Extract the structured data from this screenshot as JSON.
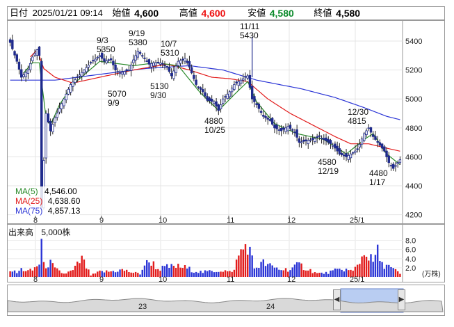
{
  "header": {
    "date_label": "日付",
    "datetime": "2025/01/21 09:14",
    "open_label": "始値",
    "open_value": "4,600",
    "high_label": "高値",
    "high_value": "4,600",
    "low_label": "安値",
    "low_value": "4,580",
    "close_label": "終値",
    "close_value": "4,580"
  },
  "legend": {
    "ma5_label": "MA(5)",
    "ma5_value": "4,546.00",
    "ma5_color": "#2a8a2a",
    "ma25_label": "MA(25)",
    "ma25_value": "4,638.60",
    "ma25_color": "#e21b1b",
    "ma75_label": "MA(75)",
    "ma75_value": "4,857.13",
    "ma75_color": "#2b35d6"
  },
  "volume": {
    "title": "出来高",
    "unit_label": "5,000株",
    "axis_unit": "(万株)",
    "ticks": [
      "8.0",
      "6.0",
      "4.0",
      "2.0"
    ]
  },
  "overview": {
    "labels": [
      "23",
      "24"
    ]
  },
  "chart_data": {
    "type": "candlestick",
    "y_ticks": [
      5400,
      5200,
      5000,
      4800,
      4600,
      4400,
      4200
    ],
    "ylim": [
      4150,
      5530
    ],
    "x_month_labels": [
      "8",
      "9",
      "10",
      "11",
      "12",
      "25/1"
    ],
    "annotations": [
      {
        "text": [
          "9/3",
          "5350"
        ]
      },
      {
        "text": [
          "9/19",
          "5380"
        ]
      },
      {
        "text": [
          "10/7",
          "5310"
        ]
      },
      {
        "text": [
          "11/11",
          "5430"
        ]
      },
      {
        "text": [
          "5070",
          "9/9"
        ]
      },
      {
        "text": [
          "5130",
          "9/30"
        ]
      },
      {
        "text": [
          "4880",
          "10/25"
        ]
      },
      {
        "text": [
          "12/30",
          "4815"
        ]
      },
      {
        "text": [
          "4580",
          "12/19"
        ]
      },
      {
        "text": [
          "4480",
          "1/17"
        ]
      }
    ],
    "close_anchors": [
      [
        0,
        5390
      ],
      [
        3,
        5260
      ],
      [
        5,
        5150
      ],
      [
        8,
        5200
      ],
      [
        10,
        5290
      ],
      [
        12,
        5340
      ],
      [
        13,
        5300
      ],
      [
        14,
        4250
      ],
      [
        16,
        4900
      ],
      [
        18,
        4780
      ],
      [
        20,
        4870
      ],
      [
        24,
        5000
      ],
      [
        27,
        5100
      ],
      [
        30,
        5150
      ],
      [
        33,
        5200
      ],
      [
        36,
        5250
      ],
      [
        40,
        5300
      ],
      [
        42,
        5260
      ],
      [
        45,
        5270
      ],
      [
        47,
        5200
      ],
      [
        49,
        5180
      ],
      [
        53,
        5200
      ],
      [
        55,
        5270
      ],
      [
        57,
        5330
      ],
      [
        60,
        5280
      ],
      [
        62,
        5240
      ],
      [
        64,
        5250
      ],
      [
        67,
        5250
      ],
      [
        70,
        5220
      ],
      [
        72,
        5160
      ],
      [
        75,
        5260
      ],
      [
        78,
        5280
      ],
      [
        80,
        5220
      ],
      [
        83,
        5100
      ],
      [
        86,
        5050
      ],
      [
        88,
        4990
      ],
      [
        91,
        4980
      ],
      [
        93,
        4920
      ],
      [
        95,
        5000
      ],
      [
        98,
        5050
      ],
      [
        100,
        5100
      ],
      [
        103,
        5130
      ],
      [
        106,
        5160
      ],
      [
        108,
        5000
      ],
      [
        110,
        4960
      ],
      [
        113,
        4880
      ],
      [
        116,
        4850
      ],
      [
        118,
        4800
      ],
      [
        121,
        4780
      ],
      [
        124,
        4810
      ],
      [
        127,
        4770
      ],
      [
        129,
        4700
      ],
      [
        132,
        4710
      ],
      [
        135,
        4720
      ],
      [
        138,
        4740
      ],
      [
        141,
        4710
      ],
      [
        144,
        4680
      ],
      [
        147,
        4620
      ],
      [
        150,
        4600
      ],
      [
        152,
        4620
      ],
      [
        155,
        4650
      ],
      [
        158,
        4760
      ],
      [
        160,
        4800
      ],
      [
        162,
        4740
      ],
      [
        165,
        4680
      ],
      [
        167,
        4640
      ],
      [
        169,
        4560
      ],
      [
        171,
        4520
      ],
      [
        173,
        4560
      ],
      [
        174,
        4580
      ]
    ],
    "ma5_anchors": [
      [
        6,
        5180
      ],
      [
        10,
        5250
      ],
      [
        13,
        5250
      ],
      [
        16,
        4870
      ],
      [
        18,
        4820
      ],
      [
        22,
        4960
      ],
      [
        28,
        5100
      ],
      [
        40,
        5260
      ],
      [
        55,
        5230
      ],
      [
        65,
        5250
      ],
      [
        75,
        5230
      ],
      [
        85,
        5040
      ],
      [
        93,
        4920
      ],
      [
        100,
        5030
      ],
      [
        106,
        5120
      ],
      [
        110,
        4980
      ],
      [
        118,
        4830
      ],
      [
        128,
        4760
      ],
      [
        140,
        4720
      ],
      [
        150,
        4620
      ],
      [
        158,
        4720
      ],
      [
        162,
        4760
      ],
      [
        168,
        4620
      ],
      [
        174,
        4546
      ]
    ],
    "ma25_anchors": [
      [
        9,
        5290
      ],
      [
        12,
        5340
      ],
      [
        15,
        5210
      ],
      [
        20,
        5150
      ],
      [
        28,
        5110
      ],
      [
        40,
        5150
      ],
      [
        55,
        5200
      ],
      [
        70,
        5240
      ],
      [
        80,
        5200
      ],
      [
        90,
        5150
      ],
      [
        98,
        5140
      ],
      [
        106,
        5120
      ],
      [
        115,
        5000
      ],
      [
        125,
        4900
      ],
      [
        135,
        4820
      ],
      [
        145,
        4740
      ],
      [
        152,
        4690
      ],
      [
        160,
        4690
      ],
      [
        168,
        4660
      ],
      [
        174,
        4639
      ]
    ],
    "ma75_anchors": [
      [
        0,
        5130
      ],
      [
        20,
        5130
      ],
      [
        40,
        5170
      ],
      [
        60,
        5210
      ],
      [
        80,
        5230
      ],
      [
        95,
        5200
      ],
      [
        110,
        5130
      ],
      [
        130,
        5070
      ],
      [
        145,
        5010
      ],
      [
        158,
        4940
      ],
      [
        168,
        4880
      ],
      [
        174,
        4857
      ]
    ],
    "volume_peaks": [
      [
        0,
        1.9
      ],
      [
        3,
        1.0
      ],
      [
        5,
        2.0
      ],
      [
        8,
        1.5
      ],
      [
        10,
        1.7
      ],
      [
        13,
        3.5
      ],
      [
        14,
        9.0
      ],
      [
        15,
        2.9
      ],
      [
        18,
        3.5
      ],
      [
        20,
        2.0
      ],
      [
        24,
        0.8
      ],
      [
        28,
        1.6
      ],
      [
        32,
        4.6
      ],
      [
        36,
        0.4
      ],
      [
        40,
        1.3
      ],
      [
        45,
        1.4
      ],
      [
        50,
        1.8
      ],
      [
        55,
        1.1
      ],
      [
        58,
        0.8
      ],
      [
        60,
        3.2
      ],
      [
        63,
        4.0
      ],
      [
        66,
        2.0
      ],
      [
        70,
        2.5
      ],
      [
        74,
        2.7
      ],
      [
        78,
        2.4
      ],
      [
        82,
        1.6
      ],
      [
        86,
        1.2
      ],
      [
        90,
        1.5
      ],
      [
        95,
        1.7
      ],
      [
        99,
        1.1
      ],
      [
        103,
        6.6
      ],
      [
        106,
        8.6
      ],
      [
        109,
        2.3
      ],
      [
        113,
        3.6
      ],
      [
        117,
        2.5
      ],
      [
        121,
        1.9
      ],
      [
        125,
        2.0
      ],
      [
        129,
        3.1
      ],
      [
        133,
        2.0
      ],
      [
        137,
        0.9
      ],
      [
        141,
        1.0
      ],
      [
        145,
        1.6
      ],
      [
        149,
        2.0
      ],
      [
        153,
        1.4
      ],
      [
        157,
        5.0
      ],
      [
        159,
        7.0
      ],
      [
        160,
        4.9
      ],
      [
        162,
        4.0
      ],
      [
        164,
        6.4
      ],
      [
        166,
        3.0
      ],
      [
        168,
        3.3
      ],
      [
        170,
        2.2
      ],
      [
        172,
        1.6
      ],
      [
        174,
        0.8
      ]
    ]
  }
}
